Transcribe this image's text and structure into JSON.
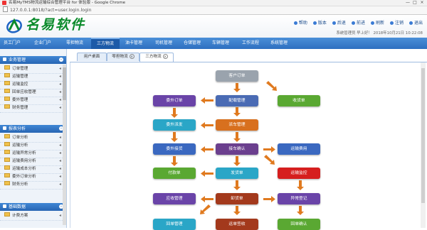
{
  "window": {
    "title": "名易MyTMS物流运输综合管理平台 for 体验版 - Google Chrome",
    "url": "127.0.0.1:8018/?act=user.login.login",
    "buttons": [
      "—",
      "□",
      "×"
    ]
  },
  "header": {
    "logo_text": "名易软件",
    "links": [
      {
        "label": "帮助",
        "icon": "help-icon"
      },
      {
        "label": "版本",
        "icon": "info-icon"
      },
      {
        "label": "后退",
        "icon": "back-icon"
      },
      {
        "label": "前进",
        "icon": "forward-icon"
      },
      {
        "label": "刷新",
        "icon": "refresh-icon"
      },
      {
        "label": "注销",
        "icon": "logout-icon"
      },
      {
        "label": "退出",
        "icon": "exit-icon"
      }
    ],
    "user_info": "系统管理员 早上好！ 2018年10月21日 10:22:08"
  },
  "nav": {
    "items": [
      "员工门户",
      "企业门户",
      "零担物流",
      "三方物流",
      "油卡管理",
      "司机管理",
      "仓储管理",
      "车辆管理",
      "工作流程",
      "系统管理"
    ],
    "active": "三方物流"
  },
  "sidebar": {
    "sections": [
      {
        "title": "业务管理",
        "items": [
          "订单管理",
          "运输管理",
          "运输监控",
          "回单应收管理",
          "委外管理",
          "财务管理"
        ]
      },
      {
        "title": "报表分析",
        "items": [
          "订单分析",
          "运输分析",
          "运输异常分析",
          "运输费用分析",
          "运输成本分析",
          "委外订单分析",
          "财务分析"
        ]
      },
      {
        "title": "基础数据",
        "items": [
          "计费方案"
        ]
      }
    ]
  },
  "tabs": [
    {
      "label": "用户桌面",
      "closable": false
    },
    {
      "label": "零担物流",
      "closable": true
    },
    {
      "label": "三方物流",
      "closable": true
    }
  ],
  "active_tab": "三方物流",
  "flow": {
    "nodes": [
      {
        "id": "n1",
        "label": "客户订单",
        "color": "#9aa3ad"
      },
      {
        "id": "n2",
        "label": "委外订单",
        "color": "#6a44a8"
      },
      {
        "id": "n3",
        "label": "配载管理",
        "color": "#4a6bb4"
      },
      {
        "id": "n4",
        "label": "收货单",
        "color": "#5aa832"
      },
      {
        "id": "n5",
        "label": "委外派发",
        "color": "#2aa6c7"
      },
      {
        "id": "n6",
        "label": "派车管理",
        "color": "#d8701e"
      },
      {
        "id": "n7",
        "label": "委外接货",
        "color": "#3a68c0"
      },
      {
        "id": "n8",
        "label": "接车确认",
        "color": "#6b3f8e"
      },
      {
        "id": "n9",
        "label": "运输费用",
        "color": "#3a68c0"
      },
      {
        "id": "n10",
        "label": "付款单",
        "color": "#5aa832"
      },
      {
        "id": "n11",
        "label": "发货单",
        "color": "#2aa6c7"
      },
      {
        "id": "n12",
        "label": "运输监控",
        "color": "#d61e1e"
      },
      {
        "id": "n13",
        "label": "应收管理",
        "color": "#6a44a8"
      },
      {
        "id": "n14",
        "label": "卸货单",
        "color": "#a3391c"
      },
      {
        "id": "n15",
        "label": "异常登记",
        "color": "#6a44a8"
      },
      {
        "id": "n16",
        "label": "回单管理",
        "color": "#2aa6c7"
      },
      {
        "id": "n17",
        "label": "运单签收",
        "color": "#a3391c"
      },
      {
        "id": "n18",
        "label": "回单确认",
        "color": "#5aa832"
      }
    ]
  },
  "colors": {
    "nav": "#2e6fc0",
    "arrow": "#e07a1f",
    "logo": "#0a8a2a"
  }
}
